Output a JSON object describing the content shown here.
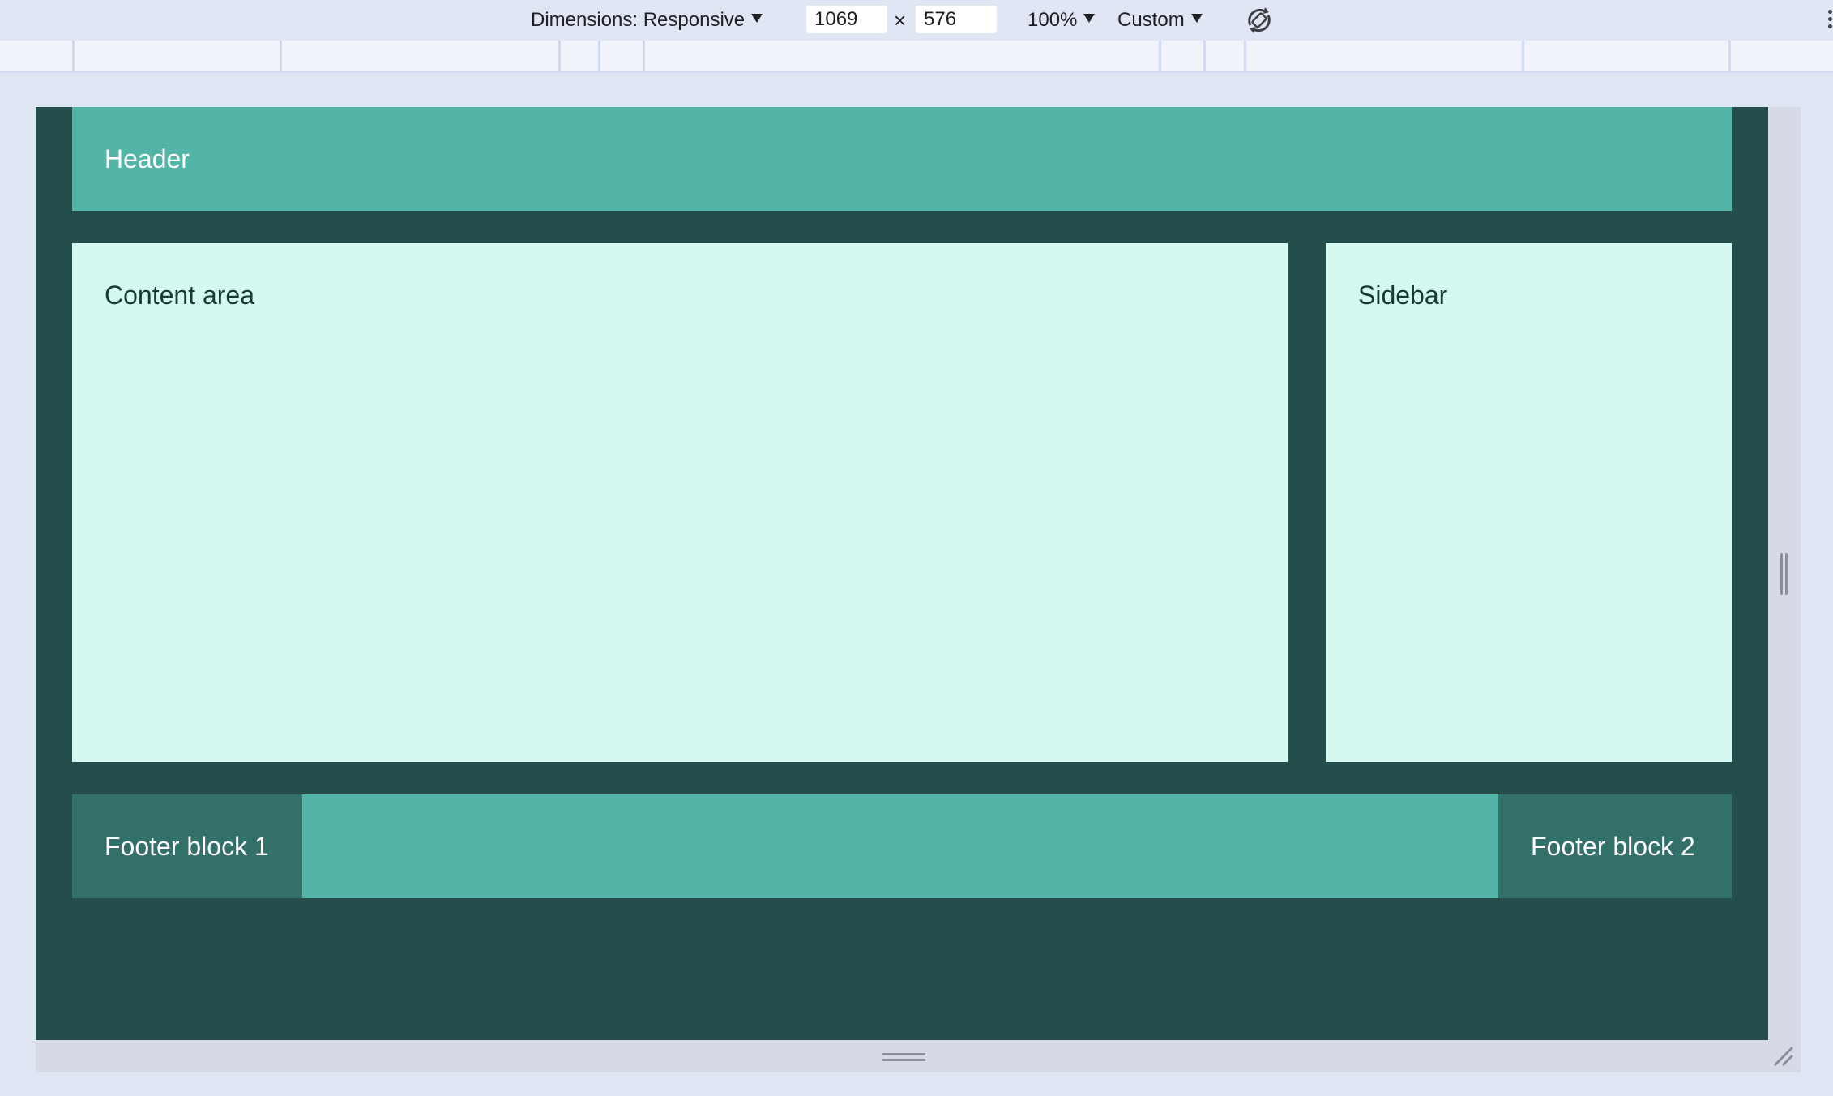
{
  "devtools_toolbar": {
    "dimensions_label": "Dimensions: Responsive",
    "width_value": "1069",
    "times_symbol": "×",
    "height_value": "576",
    "zoom_label": "100%",
    "throttle_label": "Custom",
    "rotate_icon": "rotate-icon",
    "more_icon": "kebab-menu-icon"
  },
  "page": {
    "header": "Header",
    "content": "Content area",
    "sidebar": "Sidebar",
    "footer_block_1": "Footer block 1",
    "footer_block_2": "Footer block 2"
  },
  "colors": {
    "toolbar_bg": "#e0e6f4",
    "page_bg": "#234e4b",
    "header_bg": "#53b5a7",
    "panel_bg": "#d5f9f0",
    "footer_block_bg": "#33706a"
  }
}
